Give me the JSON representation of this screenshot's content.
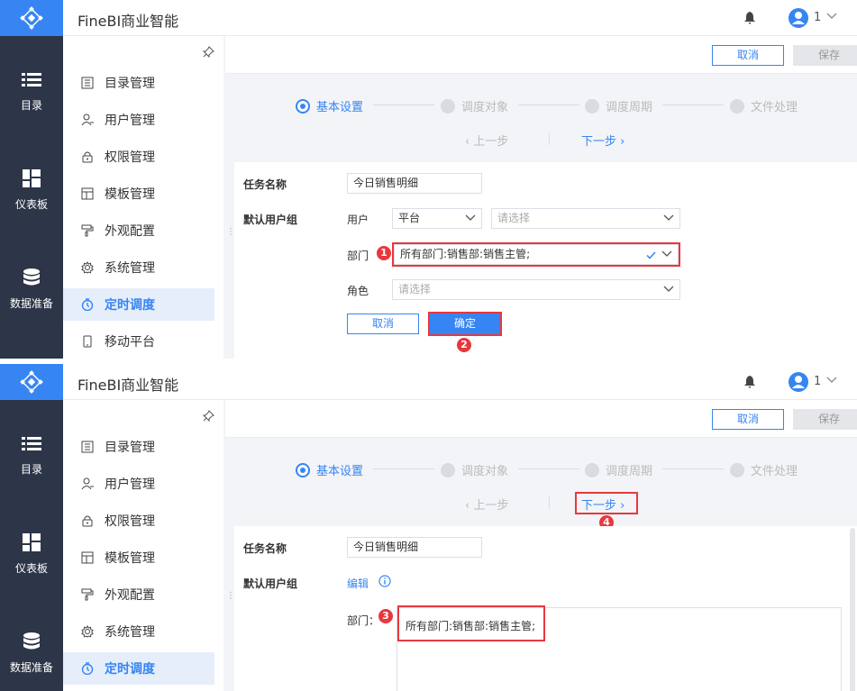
{
  "app": {
    "title": "FineBI商业智能",
    "user_name": "1"
  },
  "rail": {
    "items": [
      {
        "label": "目录",
        "icon": "list-icon"
      },
      {
        "label": "仪表板",
        "icon": "dashboard-icon"
      },
      {
        "label": "数据准备",
        "icon": "database-icon"
      }
    ]
  },
  "sidebar": {
    "items": [
      {
        "label": "目录管理",
        "icon": "catalog-icon"
      },
      {
        "label": "用户管理",
        "icon": "user-icon"
      },
      {
        "label": "权限管理",
        "icon": "lock-icon"
      },
      {
        "label": "模板管理",
        "icon": "template-icon"
      },
      {
        "label": "外观配置",
        "icon": "paint-roller-icon"
      },
      {
        "label": "系统管理",
        "icon": "gear-icon"
      },
      {
        "label": "定时调度",
        "icon": "timer-icon"
      },
      {
        "label": "移动平台",
        "icon": "mobile-icon"
      }
    ],
    "active_index": 6
  },
  "actions": {
    "cancel": "取消",
    "save": "保存"
  },
  "steps": [
    {
      "label": "基本设置"
    },
    {
      "label": "调度对象"
    },
    {
      "label": "调度周期"
    },
    {
      "label": "文件处理"
    }
  ],
  "nav": {
    "prev": "上一步",
    "next": "下一步"
  },
  "form": {
    "task_name_label": "任务名称",
    "task_name_value": "今日销售明细",
    "default_user_group_label": "默认用户组",
    "user_label": "用户",
    "user_type_value": "平台",
    "user_select_placeholder": "请选择",
    "department_label": "部门",
    "department_value": "所有部门:销售部:销售主管;",
    "role_label": "角色",
    "role_placeholder": "请选择",
    "cancel_button": "取消",
    "confirm_button": "确定",
    "edit_link": "编辑",
    "department_colon_label": "部门："
  },
  "annotations": {
    "badge1": "1",
    "badge2": "2",
    "badge3": "3",
    "badge4": "4"
  },
  "colors": {
    "accent": "#3685f2",
    "rail_bg": "#2d3548",
    "highlight": "#e8383d"
  }
}
